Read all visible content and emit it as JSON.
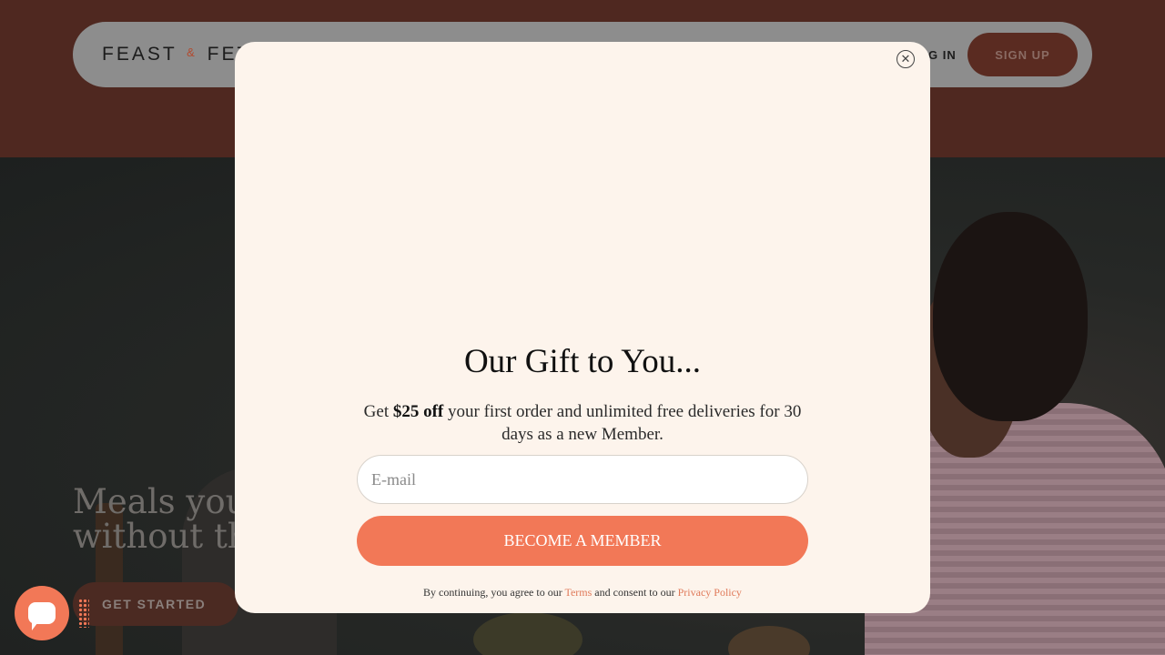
{
  "header": {
    "logo_left": "FEAST",
    "logo_amp": "&",
    "logo_right": "FETCH",
    "login_label": "LOG IN",
    "signup_label": "SIGN UP"
  },
  "hero": {
    "title_line1": "Meals you love,",
    "title_line2": "without the",
    "cta_label": "GET STARTED"
  },
  "modal": {
    "title": "Our Gift to You...",
    "desc_prefix": "Get ",
    "desc_bold": "$25 off",
    "desc_suffix": " your first order and unlimited free deliveries for 30 days as a new Member.",
    "email_placeholder": "E-mail",
    "submit_label": "BECOME A MEMBER",
    "legal_prefix": "By continuing, you agree to our ",
    "terms_label": "Terms",
    "legal_middle": " and consent to our ",
    "privacy_label": "Privacy Policy",
    "close_symbol": "✕"
  },
  "colors": {
    "brand_dark": "#4f2820",
    "accent": "#f27857",
    "modal_bg": "#fdf4ec"
  }
}
